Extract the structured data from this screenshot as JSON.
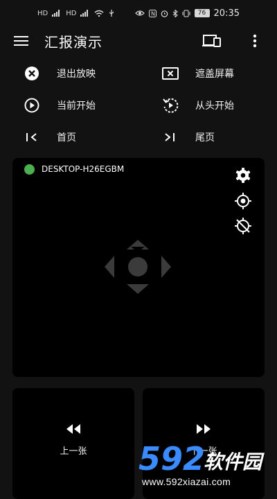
{
  "status_bar": {
    "left_icons": [
      "HD-icon",
      "signal-icon",
      "HD-icon",
      "signal-icon",
      "wifi-icon",
      "usb-icon"
    ],
    "battery": "76",
    "time": "20:35"
  },
  "appbar": {
    "title": "汇报演示",
    "icons": [
      "menu-icon",
      "cast-icon",
      "more-vert-icon"
    ]
  },
  "actions": [
    {
      "id": "exit",
      "label": "退出放映",
      "icon": "close-circle-icon"
    },
    {
      "id": "mask",
      "label": "遮盖屏幕",
      "icon": "close-box-icon"
    },
    {
      "id": "current",
      "label": "当前开始",
      "icon": "play-circle-icon"
    },
    {
      "id": "restart",
      "label": "从头开始",
      "icon": "replay-icon"
    },
    {
      "id": "first",
      "label": "首页",
      "icon": "skip-first-icon"
    },
    {
      "id": "last",
      "label": "尾页",
      "icon": "skip-last-icon"
    }
  ],
  "remote_panel": {
    "device_name": "DESKTOP-H26EGBM",
    "status_color": "#4caf50",
    "icons": [
      "settings-icon",
      "laser-pointer-icon",
      "pointer-off-icon",
      "dpad-icon"
    ]
  },
  "nav": {
    "prev_label": "上一张",
    "next_label": "下一张"
  },
  "watermark": {
    "brand": "592软件园",
    "url": "www.592xiazai.com",
    "colors": {
      "digits": "#3a8bff",
      "text": "#ffffff"
    }
  }
}
